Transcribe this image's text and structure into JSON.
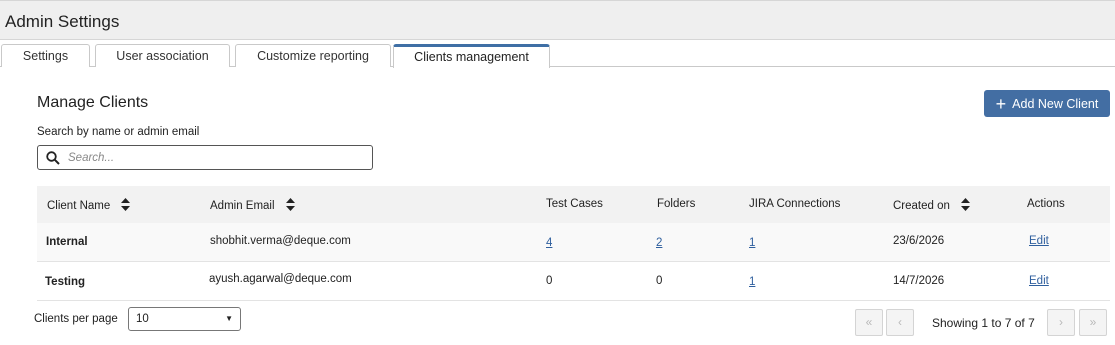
{
  "header": {
    "title": "Admin Settings"
  },
  "tabs": [
    {
      "label": "Settings",
      "active": false
    },
    {
      "label": "User association",
      "active": false
    },
    {
      "label": "Customize reporting",
      "active": false
    },
    {
      "label": "Clients management",
      "active": true
    }
  ],
  "main": {
    "title": "Manage Clients",
    "add_button_label": "Add New Client",
    "search_label": "Search by name or admin email",
    "search_placeholder": "Search...",
    "search_value": ""
  },
  "table": {
    "columns": [
      "Client Name",
      "Admin Email",
      "Test Cases",
      "Folders",
      "JIRA Connections",
      "Created on",
      "Actions"
    ],
    "sortable_columns": [
      "Client Name",
      "Admin Email",
      "Created on"
    ],
    "rows": [
      {
        "name": "Internal",
        "email": "shobhit.verma@deque.com",
        "test_cases": "4",
        "folders": "2",
        "jira": "1",
        "created": "23/6/2026",
        "action": "Edit"
      },
      {
        "name": "Testing",
        "email": "ayush.agarwal@deque.com",
        "test_cases": "0",
        "folders": "0",
        "jira": "1",
        "created": "14/7/2026",
        "action": "Edit"
      }
    ]
  },
  "footer": {
    "per_page_label": "Clients per page",
    "per_page_value": "10",
    "first_label": "«",
    "prev_label": "‹",
    "next_label": "›",
    "last_label": "»",
    "showing": "Showing 1 to 7 of 7"
  },
  "colors": {
    "accent": "#436ea3",
    "link": "#2f5f9e",
    "header_bg": "#efefef",
    "table_head_bg": "#f2f2f2"
  },
  "icons": {
    "search": "search-icon",
    "add": "plus-icon",
    "sort": "sort-icon"
  }
}
